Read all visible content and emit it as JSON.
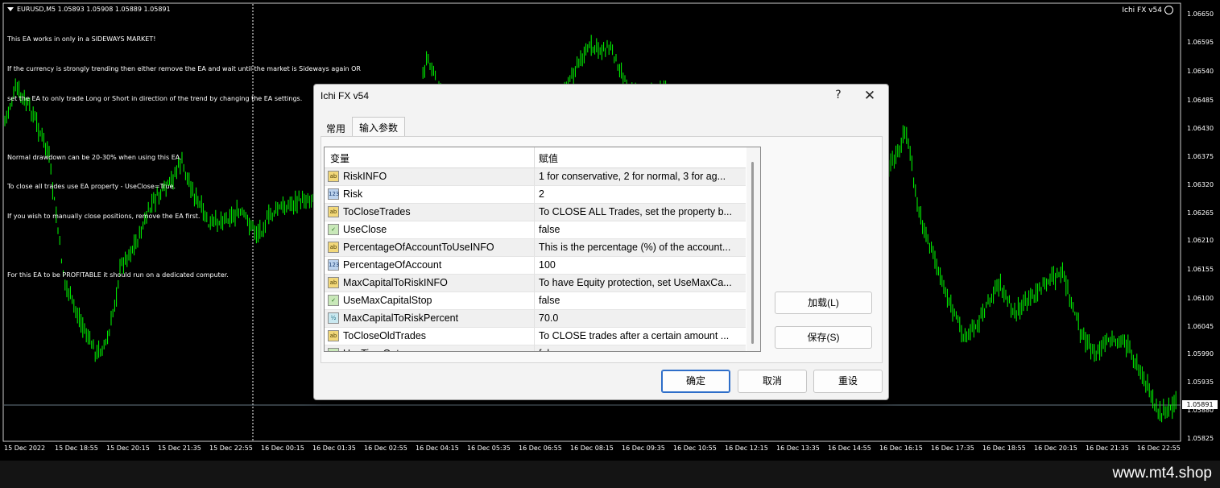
{
  "chart": {
    "symbol_line": "EURUSD,M5  1.05893 1.05908 1.05889 1.05891",
    "ea_label": "Ichi FX v54",
    "ea_comment": [
      "This EA works in only in a SIDEWAYS MARKET!",
      "If the currency is strongly trending then either remove the EA and wait until the market is Sideways again OR",
      "set the EA to only trade Long or Short in direction of the trend by changing the EA settings.",
      "",
      "Normal drawdown can be 20-30% when using this EA.",
      "To close all trades use EA property - UseClose=True.",
      "If you wish to manually close positions, remove the EA first.",
      "",
      "For this EA to be PROFITABLE it should run on a dedicated computer."
    ],
    "price_labels": [
      "1.06650",
      "1.06595",
      "1.06540",
      "1.06485",
      "1.06430",
      "1.06375",
      "1.06320",
      "1.06265",
      "1.06210",
      "1.06155",
      "1.06100",
      "1.06045",
      "1.05990",
      "1.05935",
      "1.05880",
      "1.05825"
    ],
    "current_price": "1.05891",
    "time_labels": [
      "15 Dec 2022",
      "15 Dec 18:55",
      "15 Dec 20:15",
      "15 Dec 21:35",
      "15 Dec 22:55",
      "16 Dec 00:15",
      "16 Dec 01:35",
      "16 Dec 02:55",
      "16 Dec 04:15",
      "16 Dec 05:35",
      "16 Dec 06:55",
      "16 Dec 08:15",
      "16 Dec 09:35",
      "16 Dec 10:55",
      "16 Dec 12:15",
      "16 Dec 13:35",
      "16 Dec 14:55",
      "16 Dec 16:15",
      "16 Dec 17:35",
      "16 Dec 18:55",
      "16 Dec 20:15",
      "16 Dec 21:35",
      "16 Dec 22:55"
    ],
    "candle_color": "#00ff00",
    "background": "#000000"
  },
  "dialog": {
    "title": "Ichi FX v54",
    "help_label": "?",
    "close_label": "✕",
    "tabs": [
      "常用",
      "输入参数"
    ],
    "active_tab": "输入参数",
    "table": {
      "col_variable": "变量",
      "col_value": "赋值",
      "rows": [
        {
          "icon": "string",
          "name": "RiskINFO",
          "value": "1 for conservative, 2 for normal, 3 for ag..."
        },
        {
          "icon": "int",
          "name": "Risk",
          "value": "2"
        },
        {
          "icon": "string",
          "name": "ToCloseTrades",
          "value": "To CLOSE ALL Trades, set the property b..."
        },
        {
          "icon": "bool",
          "name": "UseClose",
          "value": "false"
        },
        {
          "icon": "string",
          "name": "PercentageOfAccountToUseINFO",
          "value": "This is the percentage (%) of the account..."
        },
        {
          "icon": "int",
          "name": "PercentageOfAccount",
          "value": "100"
        },
        {
          "icon": "string",
          "name": "MaxCapitalToRiskINFO",
          "value": "To have Equity protection, set UseMaxCa..."
        },
        {
          "icon": "bool",
          "name": "UseMaxCapitalStop",
          "value": "false"
        },
        {
          "icon": "double",
          "name": "MaxCapitalToRiskPercent",
          "value": "70.0"
        },
        {
          "icon": "string",
          "name": "ToCloseOldTrades",
          "value": "To CLOSE trades after a certain amount ..."
        },
        {
          "icon": "bool",
          "name": "UseTimeOut",
          "value": "false"
        }
      ]
    },
    "load_label": "加载(L)",
    "save_label": "保存(S)",
    "ok_label": "确定",
    "cancel_label": "取消",
    "reset_label": "重设"
  },
  "watermark": "www.mt4.shop"
}
